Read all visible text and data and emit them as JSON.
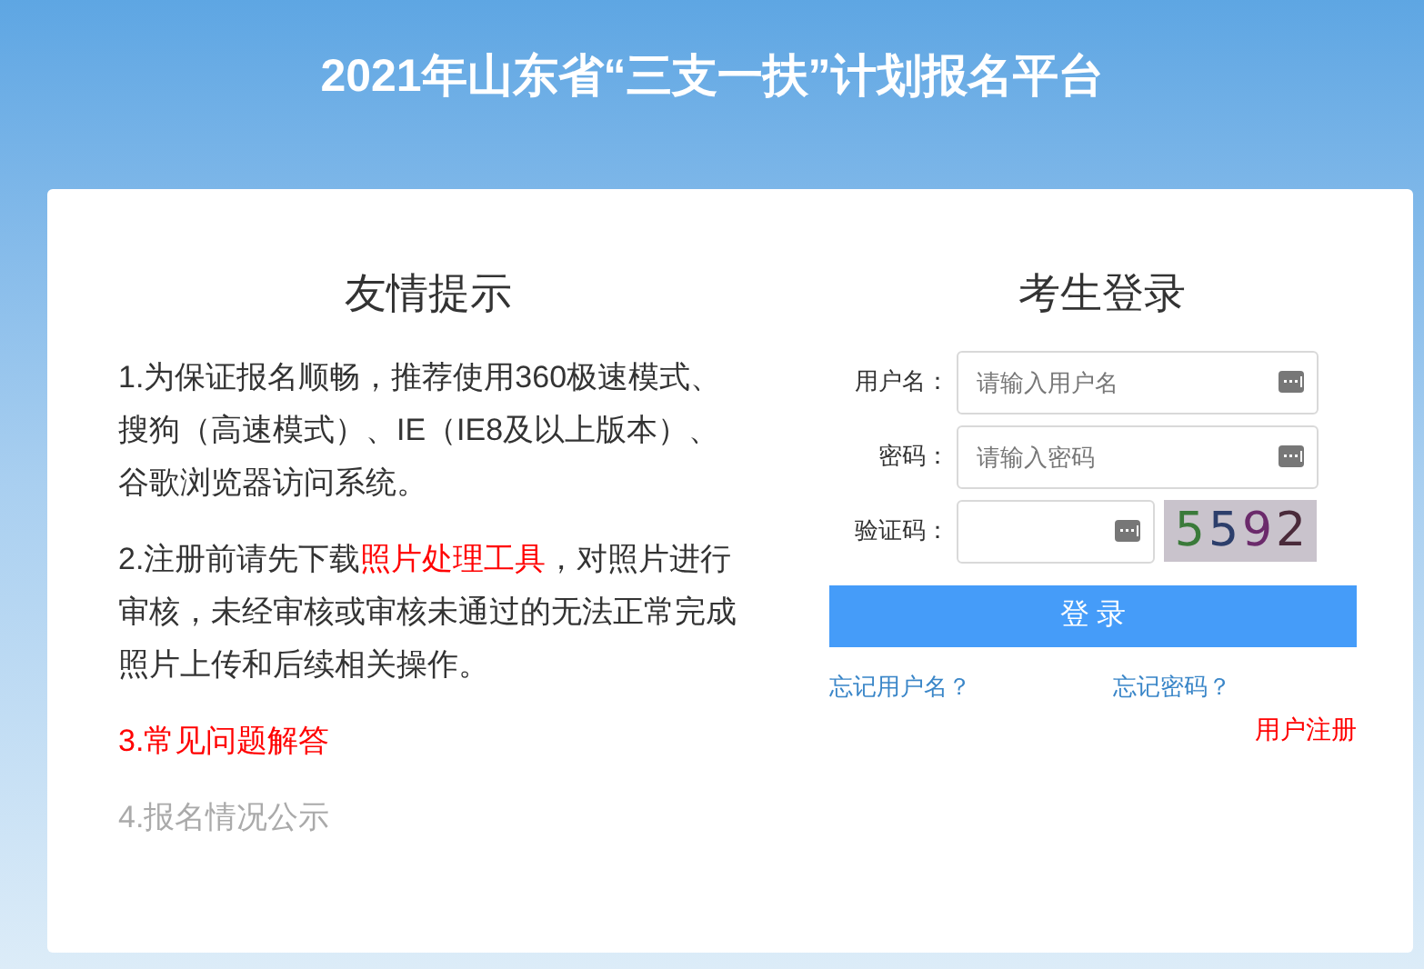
{
  "header": {
    "title": "2021年山东省“三支一扶”计划报名平台"
  },
  "notice": {
    "title": "友情提示",
    "items": [
      {
        "kind": "text",
        "text": "1.为保证报名顺畅，推荐使用360极速模式、搜狗（高速模式）、IE（IE8及以上版本）、谷歌浏览器访问系统。"
      },
      {
        "kind": "inline_link",
        "before": "2.注册前请先下载",
        "link": "照片处理工具",
        "after": "，对照片进行审核，未经审核或审核未通过的无法正常完成照片上传和后续相关操作。"
      },
      {
        "kind": "link",
        "text": "3.常见问题解答"
      },
      {
        "kind": "muted",
        "text": "4.报名情况公示"
      }
    ]
  },
  "login": {
    "title": "考生登录",
    "fields": [
      {
        "kind": "text",
        "label": "用户名：",
        "placeholder": "请输入用户名"
      },
      {
        "kind": "password",
        "label": "密码：",
        "placeholder": "请输入密码"
      },
      {
        "kind": "captcha",
        "label": "验证码：",
        "captcha": "5592"
      }
    ],
    "submit": "登 录",
    "forgot_username": "忘记用户名？",
    "forgot_password": "忘记密码？",
    "register": "用户注册"
  }
}
